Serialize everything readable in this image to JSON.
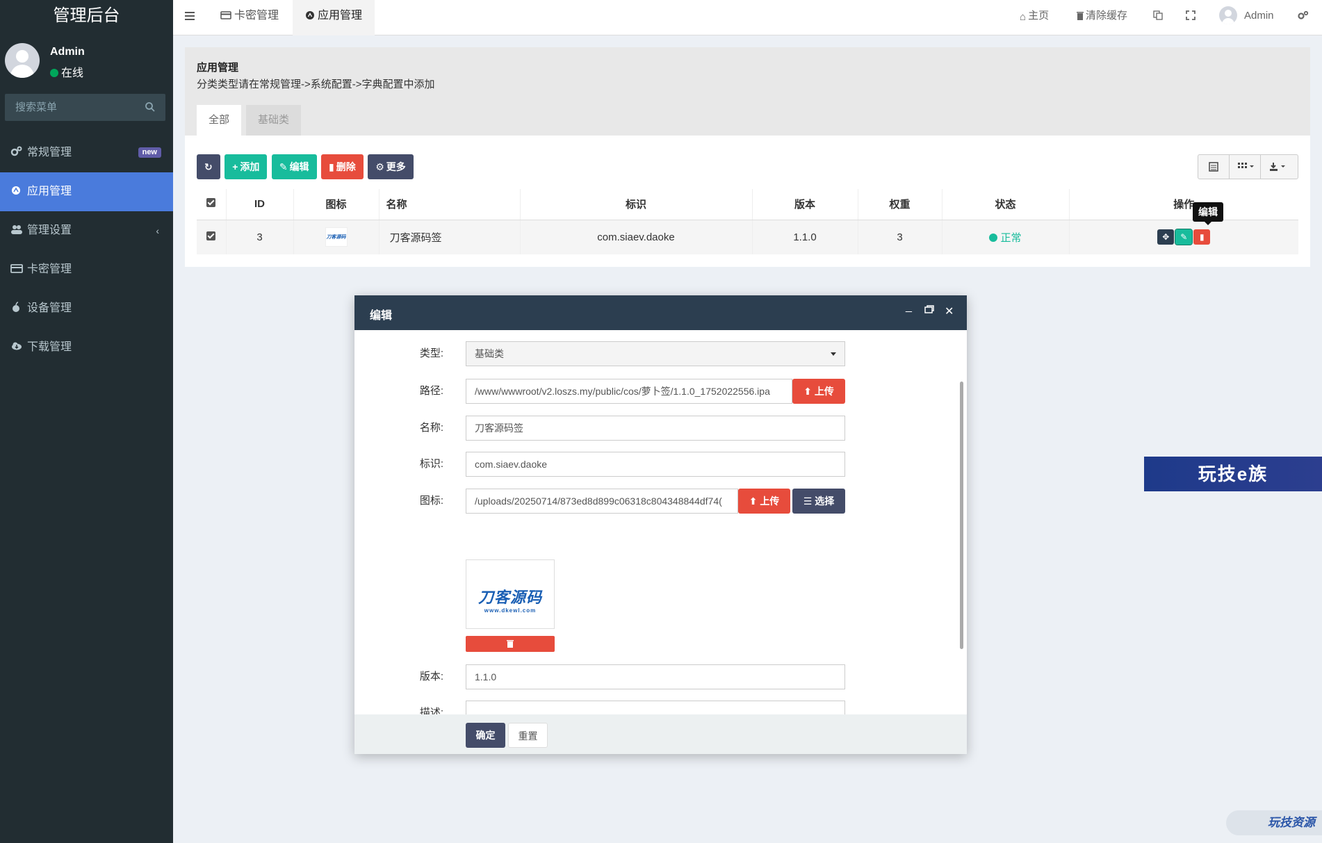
{
  "brand": "管理后台",
  "user": {
    "name": "Admin",
    "status": "在线"
  },
  "sidebar": {
    "search_placeholder": "搜索菜单",
    "items": [
      {
        "label": "常规管理",
        "icon": "cogs-icon",
        "badge": "new"
      },
      {
        "label": "应用管理",
        "icon": "circle-icon",
        "active": true
      },
      {
        "label": "管理设置",
        "icon": "users-icon"
      },
      {
        "label": "卡密管理",
        "icon": "card-icon"
      },
      {
        "label": "设备管理",
        "icon": "apple-icon"
      },
      {
        "label": "下载管理",
        "icon": "cloud-download-icon"
      }
    ]
  },
  "header": {
    "tabs": [
      {
        "label": "卡密管理"
      },
      {
        "label": "应用管理"
      }
    ],
    "home": "主页",
    "clear_cache": "清除缓存",
    "user": "Admin"
  },
  "panel": {
    "title": "应用管理",
    "desc": "分类类型请在常规管理->系统配置->字典配置中添加",
    "tabs": [
      "全部",
      "基础类"
    ]
  },
  "toolbar": {
    "add": "添加",
    "edit": "编辑",
    "delete": "删除",
    "more": "更多"
  },
  "table": {
    "headers": [
      "ID",
      "图标",
      "名称",
      "标识",
      "版本",
      "权重",
      "状态",
      "操作"
    ],
    "rows": [
      {
        "id": "3",
        "icon_text": "刀客源码",
        "name": "刀客源码签",
        "ident": "com.siaev.daoke",
        "version": "1.1.0",
        "weight": "3",
        "status": "正常"
      }
    ],
    "tooltip": "编辑"
  },
  "modal": {
    "title": "编辑",
    "fields": {
      "type_label": "类型:",
      "type_value": "基础类",
      "path_label": "路径:",
      "path_value": "/www/wwwroot/v2.loszs.my/public/cos/萝卜签/1.1.0_1752022556.ipa",
      "upload": "上传",
      "name_label": "名称:",
      "name_value": "刀客源码签",
      "ident_label": "标识:",
      "ident_value": "com.siaev.daoke",
      "icon_label": "图标:",
      "icon_value": "/uploads/20250714/873ed8d899c06318c804348844df74(",
      "choose": "选择",
      "preview_main": "刀客源码",
      "preview_sub": "www.dkewl.com",
      "version_label": "版本:",
      "version_value": "1.1.0",
      "desc_label": "描述:"
    },
    "confirm": "确定",
    "reset": "重置"
  },
  "watermarks": {
    "right": "玩技e族",
    "bottom": "玩技资源"
  }
}
